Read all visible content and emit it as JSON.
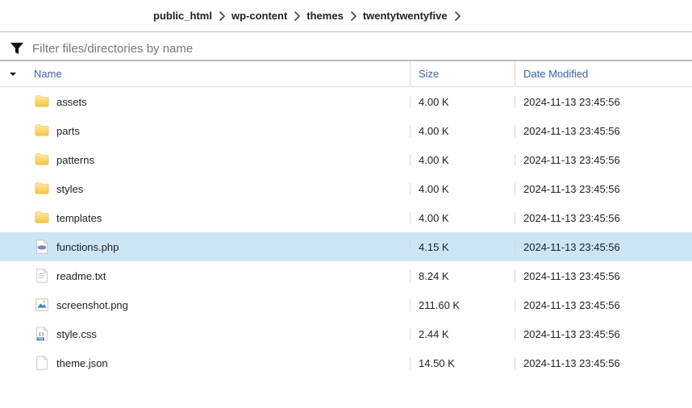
{
  "breadcrumb": {
    "items": [
      "public_html",
      "wp-content",
      "themes",
      "twentytwentyfive"
    ]
  },
  "filter": {
    "placeholder": "Filter files/directories by name"
  },
  "columns": {
    "name": "Name",
    "size": "Size",
    "date": "Date Modified"
  },
  "rows": [
    {
      "kind": "folder",
      "name": "assets",
      "size": "4.00 K",
      "date": "2024-11-13 23:45:56",
      "selected": false
    },
    {
      "kind": "folder",
      "name": "parts",
      "size": "4.00 K",
      "date": "2024-11-13 23:45:56",
      "selected": false
    },
    {
      "kind": "folder",
      "name": "patterns",
      "size": "4.00 K",
      "date": "2024-11-13 23:45:56",
      "selected": false
    },
    {
      "kind": "folder",
      "name": "styles",
      "size": "4.00 K",
      "date": "2024-11-13 23:45:56",
      "selected": false
    },
    {
      "kind": "folder",
      "name": "templates",
      "size": "4.00 K",
      "date": "2024-11-13 23:45:56",
      "selected": false
    },
    {
      "kind": "php",
      "name": "functions.php",
      "size": "4.15 K",
      "date": "2024-11-13 23:45:56",
      "selected": true
    },
    {
      "kind": "txt",
      "name": "readme.txt",
      "size": "8.24 K",
      "date": "2024-11-13 23:45:56",
      "selected": false
    },
    {
      "kind": "png",
      "name": "screenshot.png",
      "size": "211.60 K",
      "date": "2024-11-13 23:45:56",
      "selected": false
    },
    {
      "kind": "css",
      "name": "style.css",
      "size": "2.44 K",
      "date": "2024-11-13 23:45:56",
      "selected": false
    },
    {
      "kind": "json",
      "name": "theme.json",
      "size": "14.50 K",
      "date": "2024-11-13 23:45:56",
      "selected": false
    }
  ]
}
